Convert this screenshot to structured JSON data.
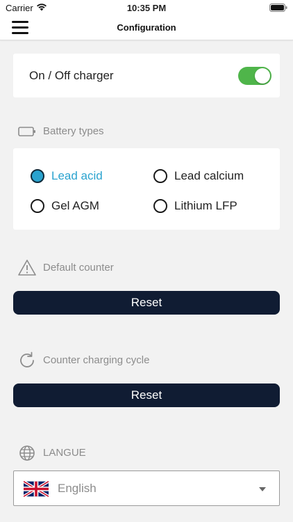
{
  "status_bar": {
    "carrier": "Carrier",
    "time": "10:35 PM"
  },
  "header": {
    "title": "Configuration",
    "menu_icon": "hamburger-menu-icon"
  },
  "charger": {
    "label": "On / Off charger",
    "enabled": true,
    "switch_color": "#4fb54a"
  },
  "battery_types": {
    "heading": "Battery types",
    "options": [
      {
        "label": "Lead acid",
        "selected": true
      },
      {
        "label": "Lead calcium",
        "selected": false
      },
      {
        "label": "Gel AGM",
        "selected": false
      },
      {
        "label": "Lithium LFP",
        "selected": false
      }
    ],
    "accent_color": "#2aa3cf"
  },
  "default_counter": {
    "heading": "Default counter",
    "button_label": "Reset"
  },
  "charging_cycle": {
    "heading": "Counter charging cycle",
    "button_label": "Reset"
  },
  "language": {
    "heading": "LANGUE",
    "selected": "English",
    "flag_icon": "uk-flag-icon"
  },
  "colors": {
    "button_bg": "#101c33",
    "background": "#f2f2f2"
  }
}
